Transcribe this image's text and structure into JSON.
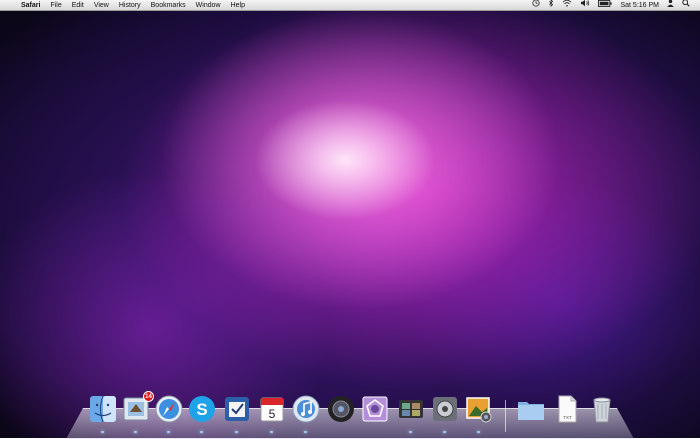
{
  "menubar": {
    "apple_glyph": "",
    "app_name": "Safari",
    "items": [
      "File",
      "Edit",
      "View",
      "History",
      "Bookmarks",
      "Window",
      "Help"
    ],
    "status": {
      "time_machine_icon": "time-machine-icon",
      "bluetooth_icon": "bluetooth-icon",
      "wifi_icon": "wifi-icon",
      "volume_icon": "volume-icon",
      "battery_icon": "battery-icon",
      "clock": "Sat 5:16 PM",
      "user_icon": "user-icon",
      "spotlight_icon": "spotlight-icon"
    }
  },
  "dock": {
    "mail_badge": "14",
    "ical_day": "5",
    "text_file_label": "TXT",
    "icons": [
      "finder",
      "mail",
      "safari",
      "skype",
      "todo",
      "ical",
      "itunes",
      "dvd-player",
      "aperture",
      "photo-booth",
      "system-preferences",
      "iphoto",
      "documents-folder",
      "text-file",
      "trash"
    ]
  },
  "colors": {
    "menubar": "#e6e6e6",
    "indicator": "#9fd0ff",
    "badge": "#d8161d"
  }
}
